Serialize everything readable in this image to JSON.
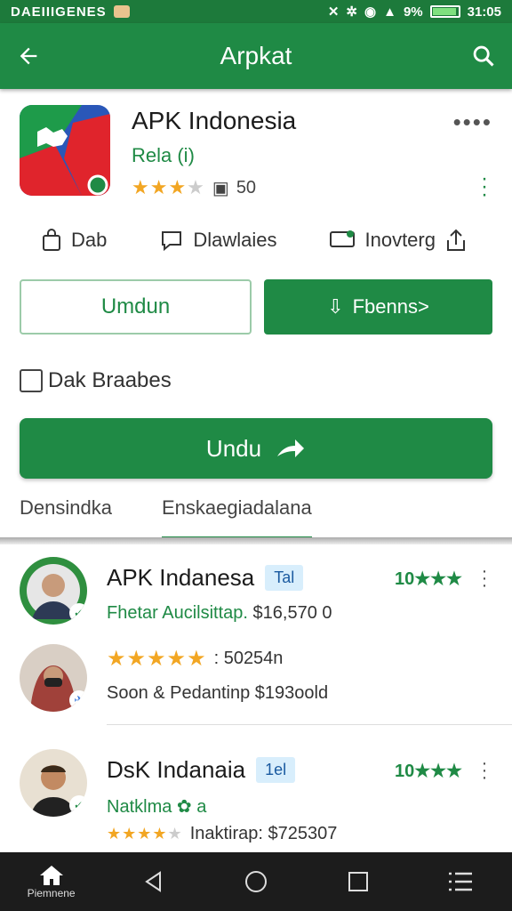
{
  "status": {
    "left": "DAEIIIGENES",
    "battery": "9%",
    "time": "31:05"
  },
  "appbar": {
    "title": "Arpkat",
    "back_icon": "arrow-left-icon",
    "search_icon": "search-icon"
  },
  "app": {
    "title": "APK Indonesia",
    "developer": "Rela (i)",
    "rating_count": "50",
    "stars": 3,
    "more": "••••"
  },
  "actions": [
    {
      "label": "Dab",
      "icon": "bag-icon"
    },
    {
      "label": "Dlawlaies",
      "icon": "chat-icon"
    },
    {
      "label": "Inovterg",
      "icon": "message-icon"
    }
  ],
  "buttons": {
    "outline": "Umdun",
    "filled": "Fbenns>"
  },
  "checkbox_label": "Dak Braabes",
  "main_button": "Undu",
  "tabs": [
    "Densindka",
    "Enskaegiadalana"
  ],
  "list": [
    {
      "title": "APK Indanesa",
      "chip": "Tal",
      "score": "10★★★",
      "subtitle": "Fhetar Aucilsittap.",
      "subtitle_price": "$16,570 0",
      "rating_text": ": 50254n",
      "rating_stars": 5,
      "line2": "Soon & Pedantinp $193oold"
    },
    {
      "title": "DsK Indanaia",
      "chip": "1el",
      "score": "10★★★",
      "subtitle": "Natklma",
      "subtitle_extra": "a",
      "rating_text": "Inaktirap: $725307",
      "rating_stars": 4
    }
  ],
  "nav": {
    "home_label": "Piemnene"
  },
  "colors": {
    "primary": "#1f8a45",
    "status": "#1d7a3b",
    "star": "#f2a623"
  }
}
